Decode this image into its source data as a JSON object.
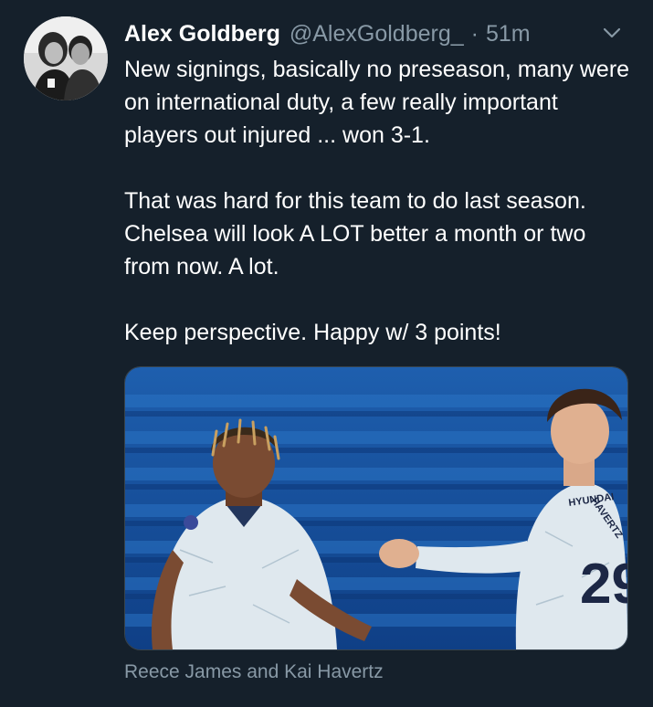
{
  "user": {
    "display_name": "Alex Goldberg",
    "handle": "@AlexGoldberg_",
    "separator": "·",
    "time": "51m"
  },
  "tweet": {
    "paragraphs": [
      "New signings, basically no preseason, many were on international duty, a few really important players out injured ... won 3-1.",
      "That was hard for this team to do last season. Chelsea will look A LOT better a month or two from now. A lot.",
      "Keep perspective. Happy w/ 3 points!"
    ]
  },
  "media": {
    "caption": "Reece James and Kai Havertz",
    "jersey_number": "29",
    "jersey_name": "HAVERTZ",
    "sponsor": "HYUNDAI"
  },
  "icons": {
    "caret": "chevron-down-icon",
    "avatar": "profile-photo"
  },
  "colors": {
    "background": "#15202b",
    "text_primary": "#ffffff",
    "text_secondary": "#8899a6",
    "border": "#38444d"
  }
}
